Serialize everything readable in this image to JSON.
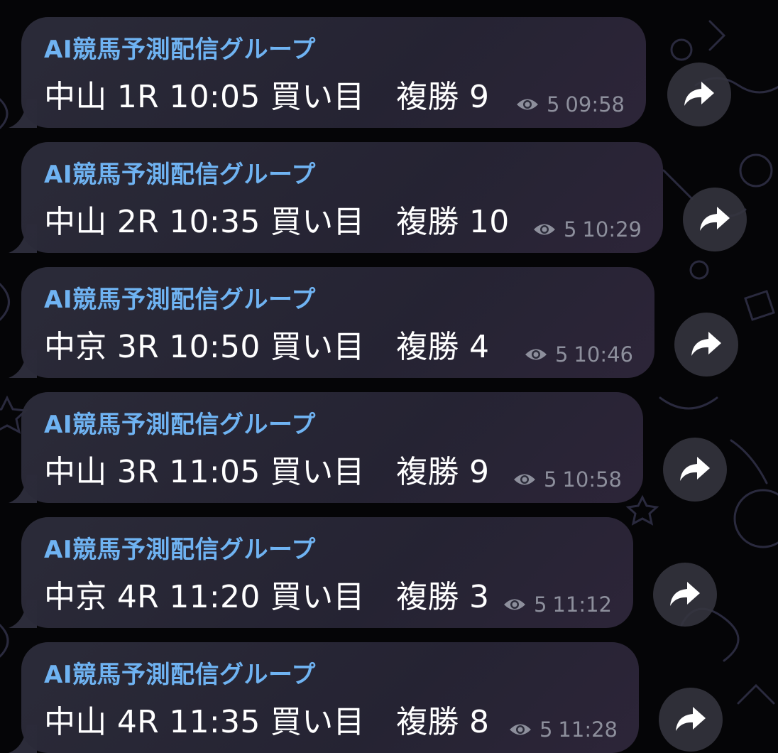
{
  "messages": [
    {
      "sender": "AI競馬予測配信グループ",
      "text": "中山 1R 10:05 買い目　複勝 9",
      "views": "5",
      "time": "09:58"
    },
    {
      "sender": "AI競馬予測配信グループ",
      "text": "中山 2R 10:35 買い目　複勝 10",
      "views": "5",
      "time": "10:29"
    },
    {
      "sender": "AI競馬予測配信グループ",
      "text": "中京 3R 10:50 買い目　複勝 4",
      "views": "5",
      "time": "10:46"
    },
    {
      "sender": "AI競馬予測配信グループ",
      "text": "中山 3R 11:05 買い目　複勝 9",
      "views": "5",
      "time": "10:58"
    },
    {
      "sender": "AI競馬予測配信グループ",
      "text": "中京 4R 11:20 買い目　複勝 3",
      "views": "5",
      "time": "11:12"
    },
    {
      "sender": "AI競馬予測配信グループ",
      "text": "中山 4R 11:35 買い目　複勝 8",
      "views": "5",
      "time": "11:28"
    }
  ],
  "icons": {
    "views": "eye-icon",
    "forward": "share-forward-icon"
  },
  "colors": {
    "sender": "#6fb3f2",
    "text": "#ffffff",
    "meta": "#8d8f9c",
    "bubble": "#2a2a3a",
    "background": "#050507"
  }
}
